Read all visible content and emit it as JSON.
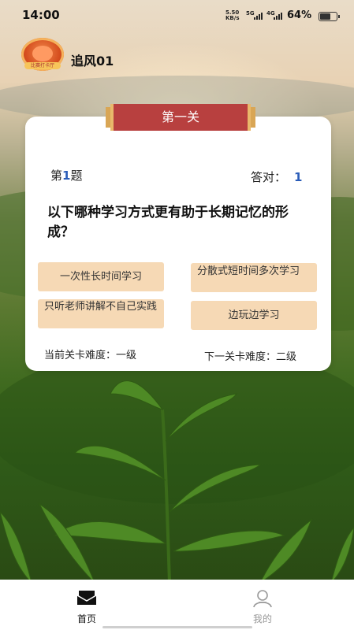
{
  "status_bar": {
    "time": "14:00",
    "net_speed_value": "5.50",
    "net_speed_unit": "KB/s",
    "sim1_label": "5G",
    "sim2_label": "4G",
    "battery_percent": "64%",
    "battery_level": 0.64
  },
  "user": {
    "name": "追风01",
    "avatar_badge": "比赛打卡厅"
  },
  "level": {
    "banner_title": "第一关"
  },
  "question": {
    "number_prefix": "第",
    "number": "1",
    "number_suffix": "题",
    "correct_label": "答对：",
    "correct_count": "1",
    "text": "以下哪种学习方式更有助于长期记忆的形成？",
    "options": [
      {
        "label": "一次性长时间学习"
      },
      {
        "label": "分散式短时间多次学习"
      },
      {
        "label": "只听老师讲解不自己实践"
      },
      {
        "label": "边玩边学习"
      }
    ]
  },
  "difficulty": {
    "current": "当前关卡难度：一级",
    "next": "下一关卡难度：二级"
  },
  "tabbar": {
    "home_label": "首页",
    "mine_label": "我的"
  },
  "icons": {
    "home": "home-icon",
    "profile": "profile-icon"
  },
  "colors": {
    "banner": "#b8403f",
    "option_bg": "#f6d9b5",
    "accent_number": "#2b5db8"
  }
}
